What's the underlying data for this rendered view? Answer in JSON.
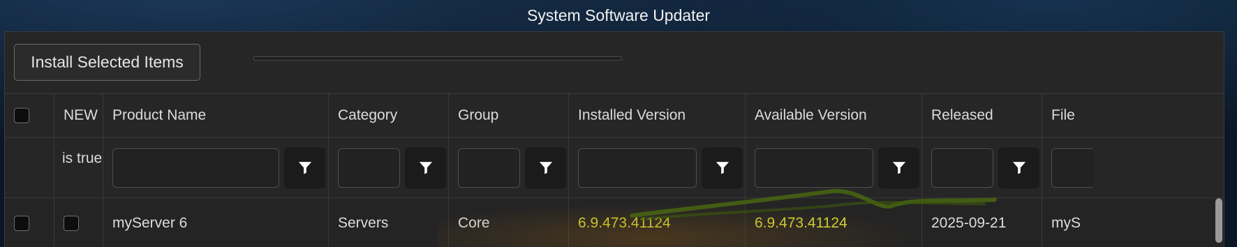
{
  "window": {
    "title": "System Software Updater"
  },
  "toolbar": {
    "install_label": "Install Selected Items",
    "progress_fraction": 0
  },
  "columns": {
    "new": "NEW",
    "product": "Product Name",
    "category": "Category",
    "group": "Group",
    "installed": "Installed Version",
    "available": "Available Version",
    "released": "Released",
    "file": "File"
  },
  "filters": {
    "new_value": "is true",
    "icon": "filter-funnel-icon"
  },
  "rows": [
    {
      "product": "myServer 6",
      "category": "Servers",
      "group": "Core",
      "installed": "6.9.473.41124",
      "available": "6.9.473.41124",
      "released": "2025-09-21",
      "file": "myS"
    }
  ],
  "colors": {
    "accent_version": "#d6d633",
    "panel_bg": "#262626"
  }
}
